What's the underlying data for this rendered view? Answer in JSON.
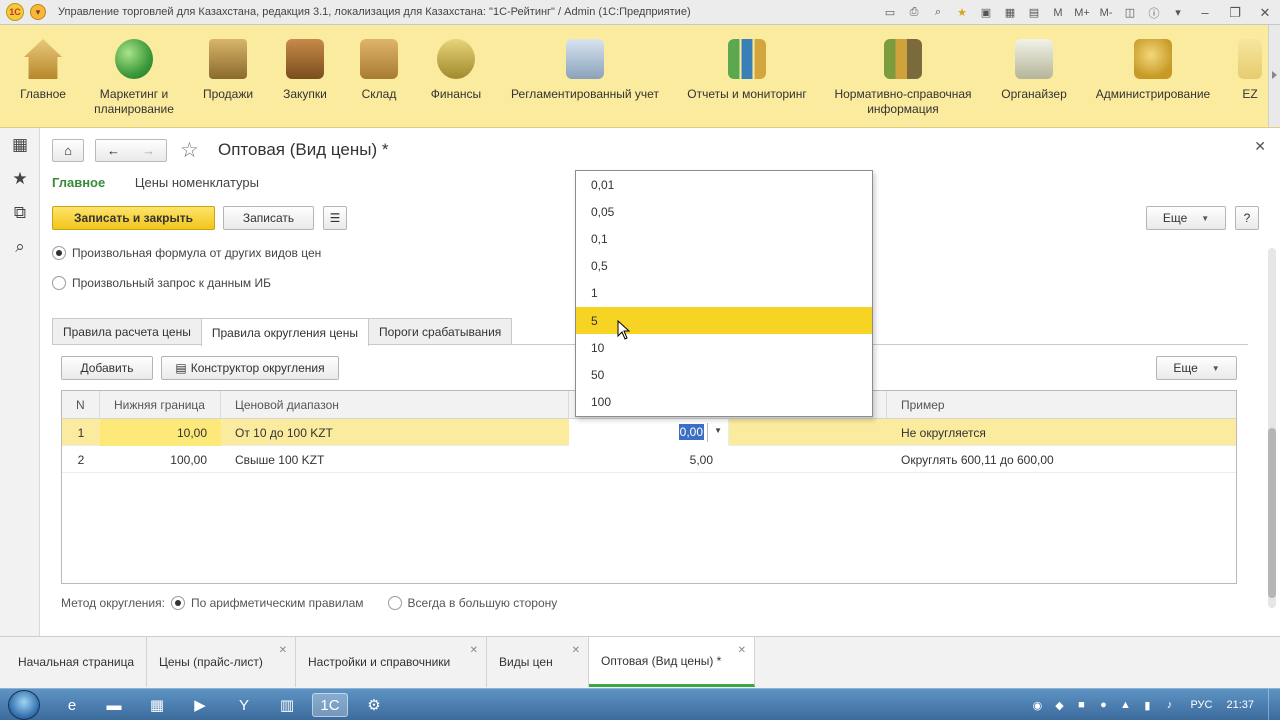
{
  "window": {
    "title": "Управление торговлей для Казахстана, редакция 3.1, локализация для Казахстана: \"1С-Рейтинг\" / Admin  (1С:Предприятие)",
    "logo_text": "1C",
    "toolbar_icons": [
      "screen-icon",
      "print-icon",
      "search-icon",
      "star-icon",
      "bookmark-icon",
      "calc-icon",
      "calendar-icon",
      "M",
      "M+",
      "M-",
      "window-icon",
      "info-icon",
      "menu-icon",
      "minimize-icon",
      "restore-icon",
      "close-icon"
    ],
    "memory_labels": [
      "M",
      "M+",
      "M-"
    ],
    "controls": {
      "minimize": "–",
      "restore": "❐",
      "close": "✕"
    }
  },
  "sections": [
    {
      "label": "Главное",
      "icon": "house"
    },
    {
      "label": "Маркетинг и\nпланирование",
      "icon": "globe"
    },
    {
      "label": "Продажи",
      "icon": "truck"
    },
    {
      "label": "Закупки",
      "icon": "cart"
    },
    {
      "label": "Склад",
      "icon": "boxes"
    },
    {
      "label": "Финансы",
      "icon": "money"
    },
    {
      "label": "Регламентированный учет",
      "icon": "docs"
    },
    {
      "label": "Отчеты и мониторинг",
      "icon": "chart"
    },
    {
      "label": "Нормативно-справочная\nинформация",
      "icon": "folders"
    },
    {
      "label": "Органайзер",
      "icon": "clip"
    },
    {
      "label": "Администрирование",
      "icon": "gear"
    },
    {
      "label": "EZ",
      "icon": "ez"
    }
  ],
  "left_toolbar": [
    "apps-grid-icon",
    "favorites-star-icon",
    "history-icon",
    "search-icon"
  ],
  "form": {
    "title": "Оптовая (Вид цены) *",
    "links": {
      "active": "Главное",
      "other": "Цены номенклатуры"
    },
    "buttons": {
      "save_close": "Записать и закрыть",
      "save": "Записать",
      "more": "Еще",
      "help": "?"
    },
    "radio_formula": "Произвольная формула от других видов цен",
    "radio_query": "Произвольный запрос к данным ИБ",
    "tabs": [
      "Правила расчета цены",
      "Правила округления цены",
      "Пороги срабатывания"
    ],
    "active_tab": 1,
    "table_buttons": {
      "add": "Добавить",
      "constructor": "Конструктор округления",
      "more": "Еще"
    },
    "table": {
      "columns": [
        "N",
        "Нижняя граница",
        "Ценовой диапазон",
        "",
        "Пример"
      ],
      "rows": [
        {
          "n": "1",
          "lower": "10,00",
          "range": "От 10 до 100 KZT",
          "accuracy": "0,00",
          "example": "Не округляется"
        },
        {
          "n": "2",
          "lower": "100,00",
          "range": "Свыше 100 KZT",
          "accuracy": "5,00",
          "example": "Округлять 600,11 до 600,00"
        }
      ]
    },
    "rounding_method": {
      "label": "Метод округления:",
      "options": [
        "По арифметическим правилам",
        "Всегда в большую сторону"
      ],
      "selected": 0
    },
    "dropdown": {
      "items": [
        "0,01",
        "0,05",
        "0,1",
        "0,5",
        "1",
        "5",
        "10",
        "50",
        "100"
      ],
      "highlighted": 5
    }
  },
  "open_windows": [
    {
      "label": "Начальная страница",
      "closable": false
    },
    {
      "label": "Цены (прайс-лист)",
      "closable": true
    },
    {
      "label": "Настройки и справочники",
      "closable": true
    },
    {
      "label": "Виды цен",
      "closable": true
    },
    {
      "label": "Оптовая (Вид цены) *",
      "closable": true,
      "active": true
    }
  ],
  "taskbar": {
    "apps": [
      "ie-icon",
      "explorer-icon",
      "excel-icon",
      "media-icon",
      "yandex-icon",
      "notes-icon",
      "1c-icon",
      "tools-icon"
    ],
    "active_app": 6,
    "language": "РУС",
    "time": "21:37"
  }
}
